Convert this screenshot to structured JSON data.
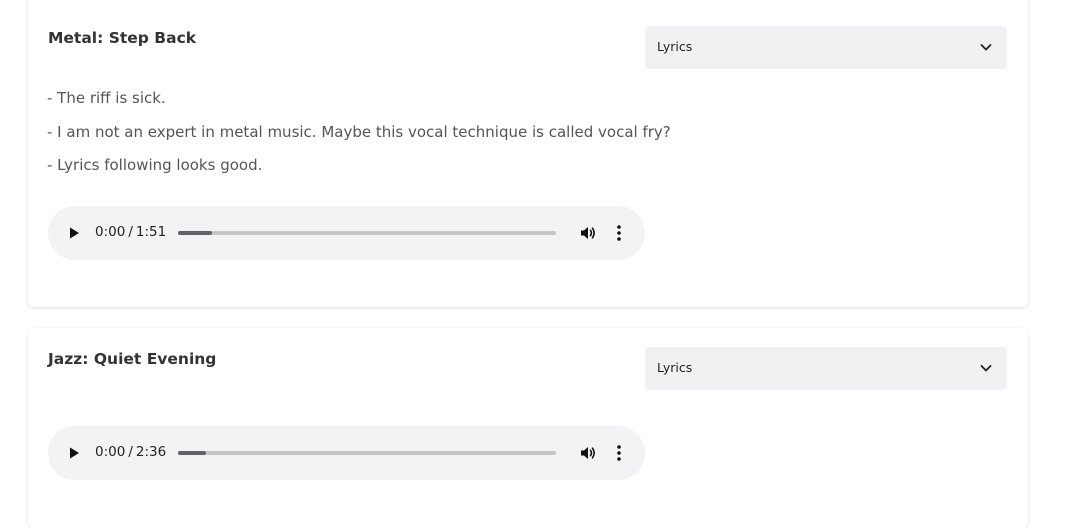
{
  "cards": [
    {
      "title": "Metal: Step Back",
      "select": {
        "value": "Lyrics",
        "icon": "chevron-down-icon"
      },
      "notes": [
        "- The riff is sick.",
        "- I am not an expert in metal music. Maybe this vocal technique is called vocal fry?",
        "- Lyrics following looks good."
      ],
      "player": {
        "current": "0:00",
        "separator": "/",
        "duration": "1:51",
        "buffered_fraction": 0.09
      }
    },
    {
      "title": "Jazz: Quiet Evening",
      "select": {
        "value": "Lyrics",
        "icon": "chevron-down-icon"
      },
      "notes": [],
      "player": {
        "current": "0:00",
        "separator": "/",
        "duration": "2:36",
        "buffered_fraction": 0.075
      }
    }
  ],
  "colors": {
    "select_bg": "#f0f1f2",
    "player_bg": "#f1f3f4",
    "track": "#c4c6c8",
    "track_fill": "#5f6368",
    "title_text": "#333333",
    "body_text": "#555555"
  }
}
